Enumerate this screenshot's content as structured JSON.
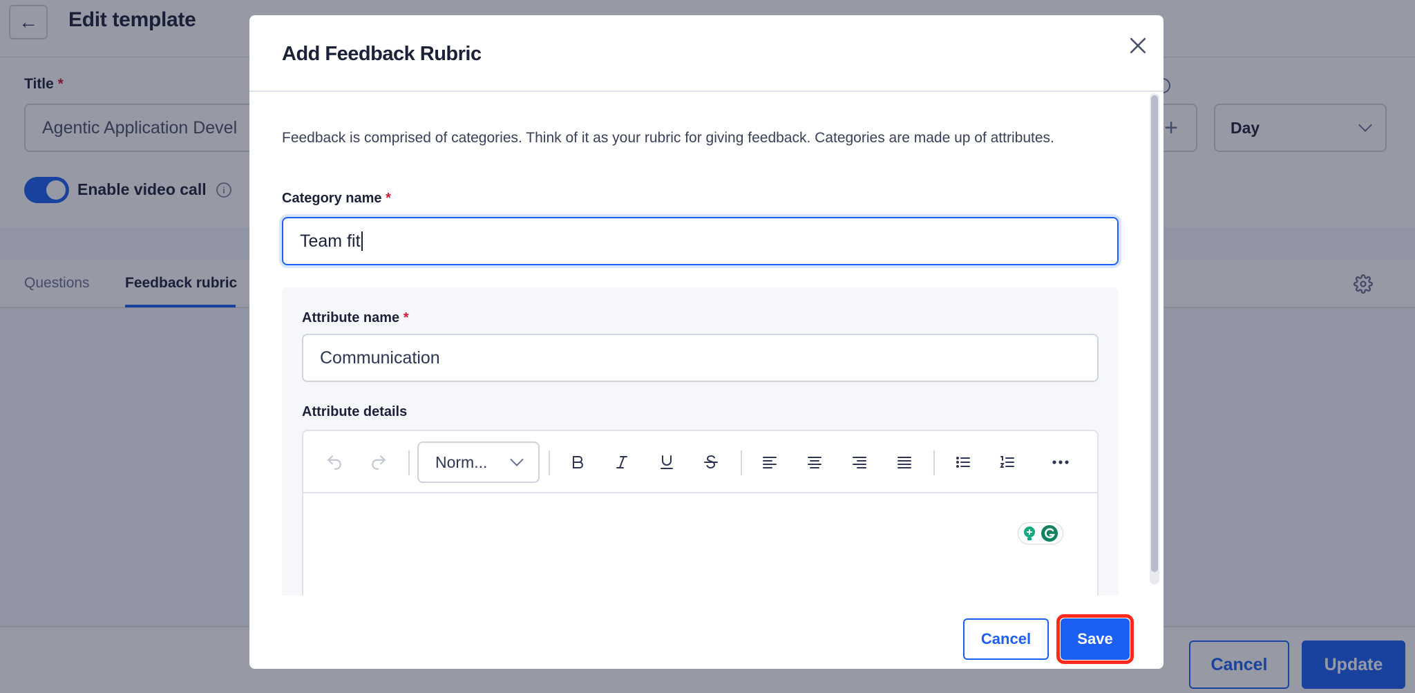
{
  "page": {
    "title": "Edit template",
    "back_icon": "arrow-left-icon",
    "form": {
      "title_label": "Title",
      "required_mark": "*",
      "title_value": "Agentic Application Devel",
      "video_toggle_label": "Enable video call",
      "video_toggle_on": true,
      "duration_unit": "Day",
      "plus_icon": "plus-icon"
    },
    "tabs": [
      {
        "label": "Questions",
        "active": false
      },
      {
        "label": "Feedback rubric",
        "active": true
      }
    ],
    "footer": {
      "cancel_label": "Cancel",
      "update_label": "Update"
    }
  },
  "modal": {
    "title": "Add Feedback Rubric",
    "description": "Feedback is comprised of categories. Think of it as your rubric for giving feedback. Categories are made up of attributes.",
    "category": {
      "label": "Category name",
      "required_mark": "*",
      "value": "Team fit"
    },
    "attribute": {
      "name_label": "Attribute name",
      "required_mark": "*",
      "name_value": "Communication",
      "details_label": "Attribute details"
    },
    "editor": {
      "block_format": "Norm...",
      "toolbar_icons": [
        "undo-icon",
        "redo-icon",
        "bold-icon",
        "italic-icon",
        "underline-icon",
        "strikethrough-icon",
        "align-left-icon",
        "align-center-icon",
        "align-right-icon",
        "align-justify-icon",
        "bullet-list-icon",
        "numbered-list-icon",
        "more-icon"
      ]
    },
    "buttons": {
      "cancel_label": "Cancel",
      "save_label": "Save"
    }
  },
  "colors": {
    "accent": "#1b5ff5",
    "highlight_ring": "#ff2a1c",
    "required": "#d11a3a"
  }
}
